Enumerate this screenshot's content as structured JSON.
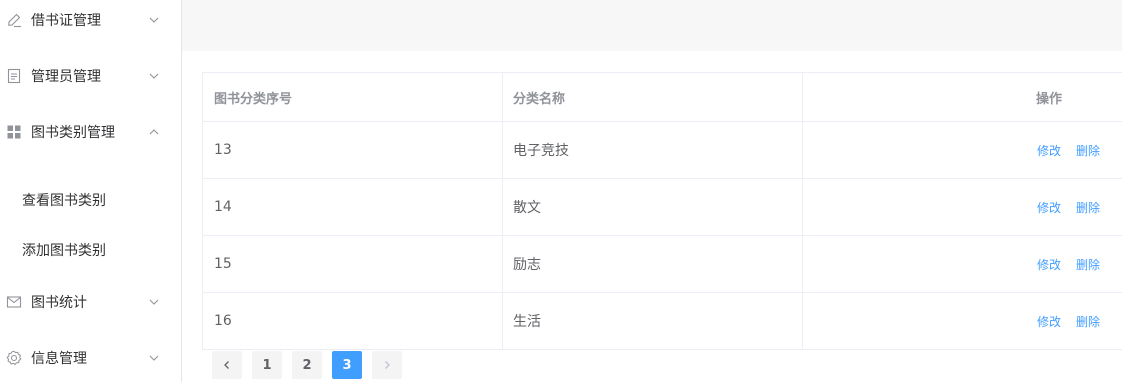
{
  "sidebar": {
    "items": [
      {
        "label": "借书证管理",
        "icon": "edit-icon",
        "expanded": false
      },
      {
        "label": "管理员管理",
        "icon": "document-icon",
        "expanded": false
      },
      {
        "label": "图书类别管理",
        "icon": "grid-icon",
        "expanded": true
      },
      {
        "label": "图书统计",
        "icon": "message-icon",
        "expanded": false
      },
      {
        "label": "信息管理",
        "icon": "setting-icon",
        "expanded": false
      }
    ],
    "subitems": [
      {
        "label": "查看图书类别"
      },
      {
        "label": "添加图书类别"
      }
    ]
  },
  "table": {
    "headers": {
      "id": "图书分类序号",
      "name": "分类名称",
      "actions": "操作"
    },
    "rows": [
      {
        "id": "13",
        "name": "电子竞技"
      },
      {
        "id": "14",
        "name": "散文"
      },
      {
        "id": "15",
        "name": "励志"
      },
      {
        "id": "16",
        "name": "生活"
      }
    ],
    "edit_label": "修改",
    "delete_label": "删除"
  },
  "pagination": {
    "prev_icon": "chevron-left-icon",
    "next_icon": "chevron-right-icon",
    "pages": [
      "1",
      "2",
      "3"
    ],
    "current": "3"
  },
  "colors": {
    "accent": "#409eff",
    "topbar_bg": "#f7f7f7",
    "border": "#ebeef5"
  }
}
